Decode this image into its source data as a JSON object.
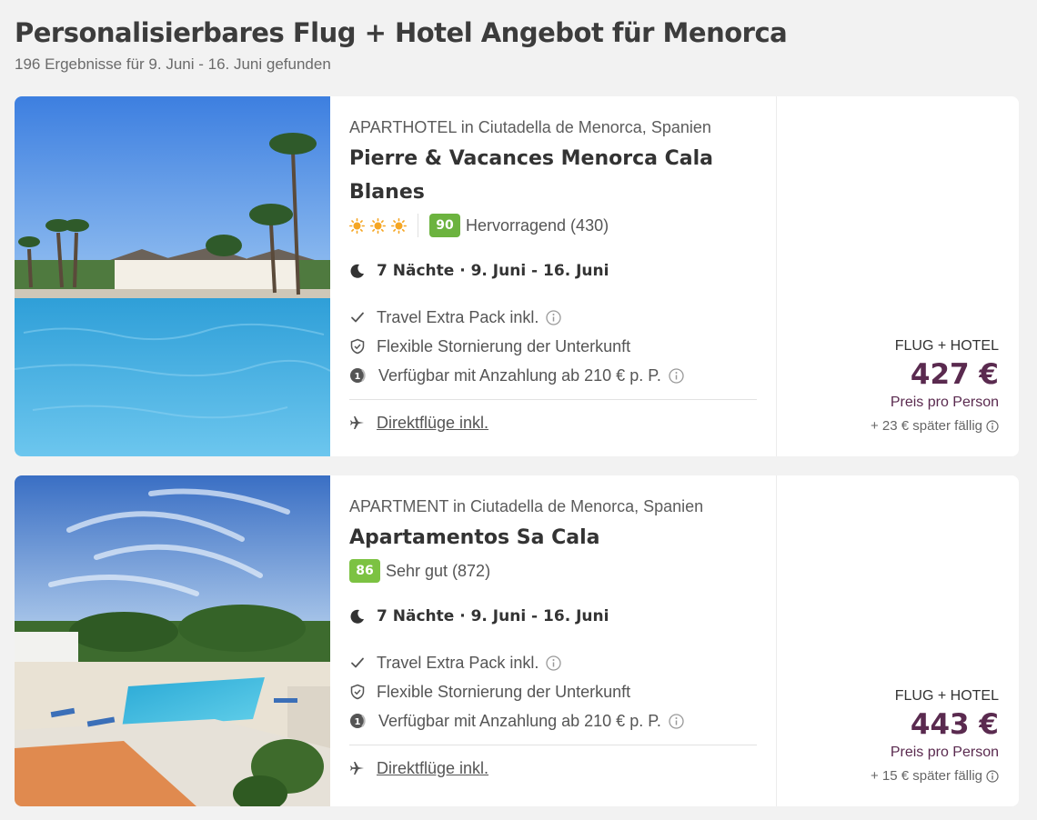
{
  "header": {
    "title": "Personalisierbares Flug + Hotel Angebot für Menorca",
    "subtitle": "196 Ergebnisse für 9. Juni - 16. Juni gefunden"
  },
  "offers": [
    {
      "type_location": "APARTHOTEL in Ciutadella de Menorca, Spanien",
      "name": "Pierre & Vacances Menorca Cala Blanes",
      "suns": 3,
      "score": "90",
      "rating_text": "Hervorragend (430)",
      "nights": "7 Nächte · 9. Juni - 16. Juni",
      "features": {
        "travel_extra": "Travel Extra Pack inkl.",
        "cancellation": "Flexible Stornierung der Unterkunft",
        "deposit": "Verfügbar mit Anzahlung ab 210 € p. P."
      },
      "flights": "Direktflüge inkl.",
      "price_label": "FLUG + HOTEL",
      "price": "427 €",
      "per_person": "Preis pro Person",
      "later_due": "+ 23 € später fällig"
    },
    {
      "type_location": "APARTMENT in Ciutadella de Menorca, Spanien",
      "name": "Apartamentos Sa Cala",
      "score": "86",
      "rating_text": "Sehr gut (872)",
      "nights": "7 Nächte · 9. Juni - 16. Juni",
      "features": {
        "travel_extra": "Travel Extra Pack inkl.",
        "cancellation": "Flexible Stornierung der Unterkunft",
        "deposit": "Verfügbar mit Anzahlung ab 210 € p. P."
      },
      "flights": "Direktflüge inkl.",
      "price_label": "FLUG + HOTEL",
      "price": "443 €",
      "per_person": "Preis pro Person",
      "later_due": "+ 15 € später fällig"
    }
  ],
  "colors": {
    "price": "#5a2a4f",
    "score_90": "#6cb33f",
    "score_86": "#7cc242",
    "sun": "#f5a623"
  }
}
